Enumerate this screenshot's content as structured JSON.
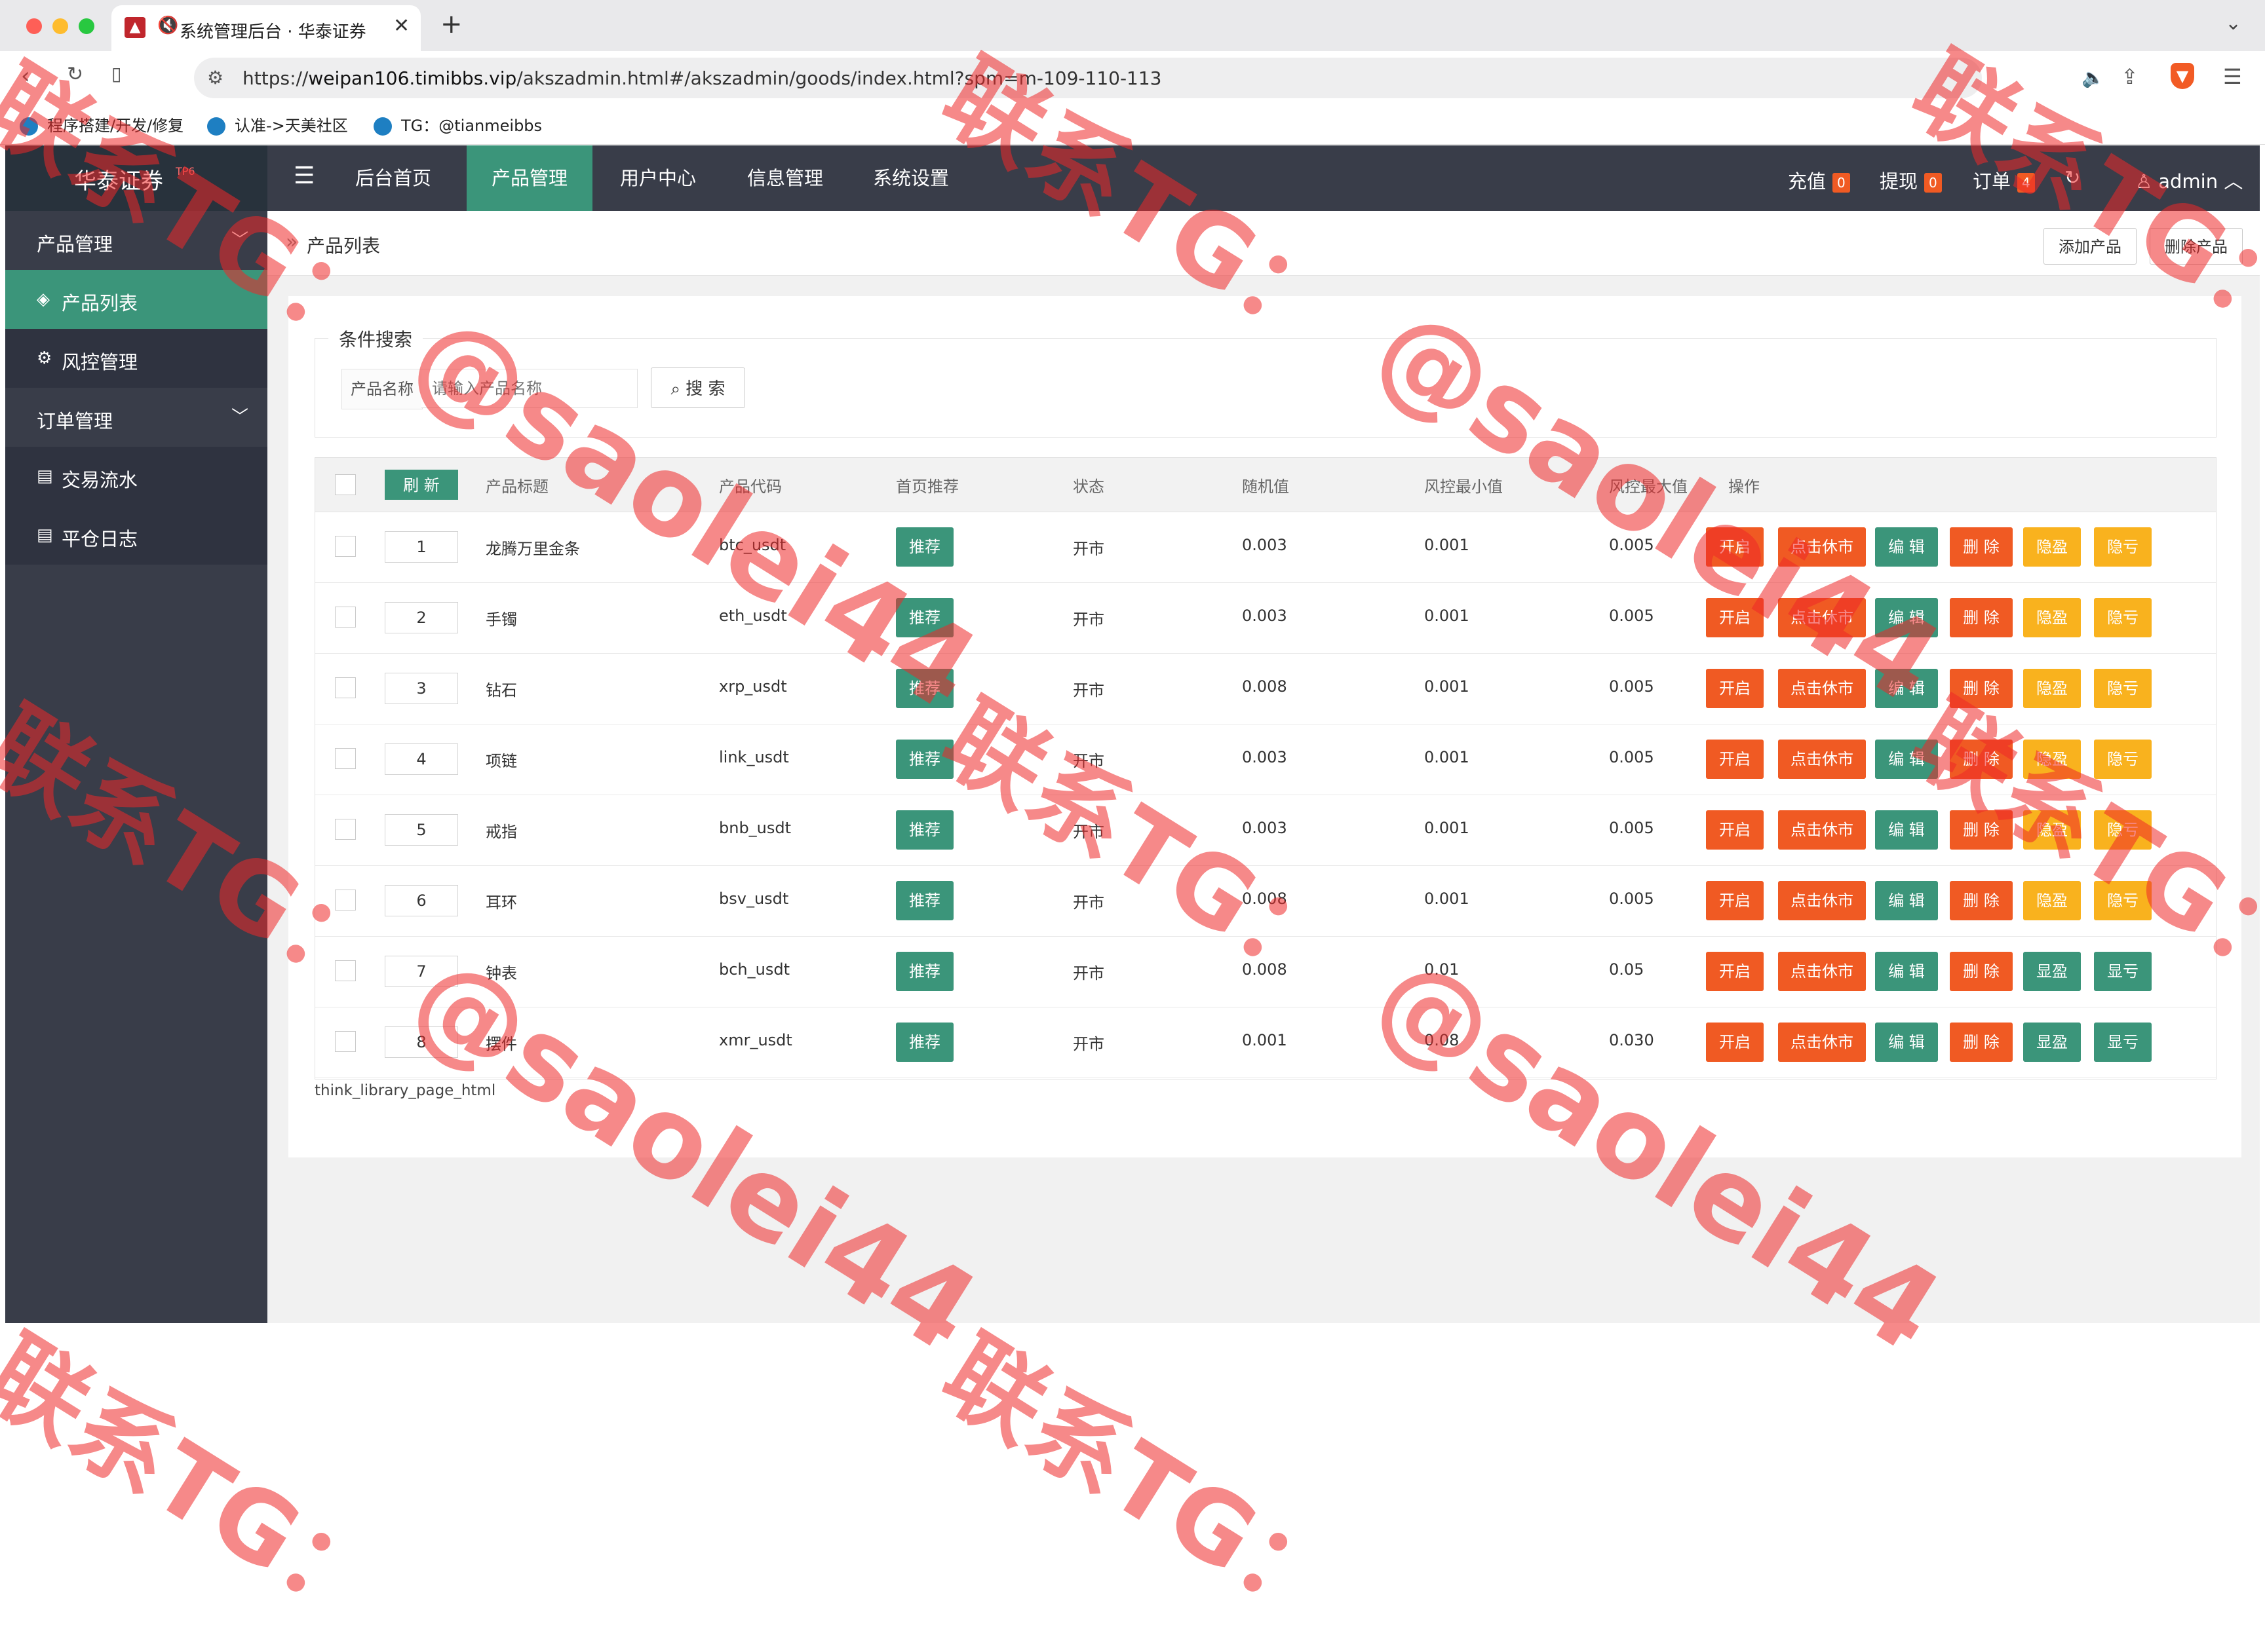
{
  "browser": {
    "tab_title": "系统管理后台 · 华泰证券",
    "url_prefix": "https://",
    "url_host": "weipan106.timibbs.vip",
    "url_path": "/akszadmin.html#/akszadmin/goods/index.html?spm=m-109-110-113",
    "bookmarks": [
      "程序搭建/开发/修复",
      "认准->天美社区",
      "TG：@tianmeibbs"
    ]
  },
  "brand": {
    "name": "华泰证券",
    "tag": "TP6"
  },
  "topnav": {
    "items": [
      "后台首页",
      "产品管理",
      "用户中心",
      "信息管理",
      "系统设置"
    ],
    "active": "产品管理",
    "right": {
      "recharge_label": "充值",
      "recharge_count": "0",
      "withdraw_label": "提现",
      "withdraw_count": "0",
      "order_label": "订单",
      "order_count": "4",
      "user": "admin"
    }
  },
  "sidebar": {
    "groups": [
      {
        "label": "产品管理",
        "items": [
          "产品列表",
          "风控管理"
        ]
      },
      {
        "label": "订单管理",
        "items": [
          "交易流水",
          "平仓日志"
        ]
      }
    ],
    "active": "产品列表"
  },
  "breadcrumb": {
    "title": "产品列表",
    "add_button": "添加产品",
    "delete_button": "删除产品"
  },
  "search": {
    "legend": "条件搜索",
    "field_label": "产品名称",
    "placeholder": "请输入产品名称",
    "button": "搜 索"
  },
  "table": {
    "refresh_button": "刷 新",
    "columns": [
      "产品标题",
      "产品代码",
      "首页推荐",
      "状态",
      "随机值",
      "风控最小值",
      "风控最大值",
      "操作"
    ],
    "rows": [
      {
        "sort": "1",
        "title": "龙腾万里金条",
        "code": "btc_usdt",
        "recommend": "推荐",
        "status": "开市",
        "random": "0.003",
        "min": "0.001",
        "max": "0.005",
        "actions": [
          "开启",
          "点击休市",
          "编 辑",
          "删 除",
          "隐盈",
          "隐亏"
        ]
      },
      {
        "sort": "2",
        "title": "手镯",
        "code": "eth_usdt",
        "recommend": "推荐",
        "status": "开市",
        "random": "0.003",
        "min": "0.001",
        "max": "0.005",
        "actions": [
          "开启",
          "点击休市",
          "编 辑",
          "删 除",
          "隐盈",
          "隐亏"
        ]
      },
      {
        "sort": "3",
        "title": "钻石",
        "code": "xrp_usdt",
        "recommend": "推荐",
        "status": "开市",
        "random": "0.008",
        "min": "0.001",
        "max": "0.005",
        "actions": [
          "开启",
          "点击休市",
          "编 辑",
          "删 除",
          "隐盈",
          "隐亏"
        ]
      },
      {
        "sort": "4",
        "title": "项链",
        "code": "link_usdt",
        "recommend": "推荐",
        "status": "开市",
        "random": "0.003",
        "min": "0.001",
        "max": "0.005",
        "actions": [
          "开启",
          "点击休市",
          "编 辑",
          "删 除",
          "隐盈",
          "隐亏"
        ]
      },
      {
        "sort": "5",
        "title": "戒指",
        "code": "bnb_usdt",
        "recommend": "推荐",
        "status": "开市",
        "random": "0.003",
        "min": "0.001",
        "max": "0.005",
        "actions": [
          "开启",
          "点击休市",
          "编 辑",
          "删 除",
          "隐盈",
          "隐亏"
        ]
      },
      {
        "sort": "6",
        "title": "耳环",
        "code": "bsv_usdt",
        "recommend": "推荐",
        "status": "开市",
        "random": "0.008",
        "min": "0.001",
        "max": "0.005",
        "actions": [
          "开启",
          "点击休市",
          "编 辑",
          "删 除",
          "隐盈",
          "隐亏"
        ]
      },
      {
        "sort": "7",
        "title": "钟表",
        "code": "bch_usdt",
        "recommend": "推荐",
        "status": "开市",
        "random": "0.008",
        "min": "0.01",
        "max": "0.05",
        "actions": [
          "开启",
          "点击休市",
          "编 辑",
          "删 除",
          "显盈",
          "显亏"
        ]
      },
      {
        "sort": "8",
        "title": "摆件",
        "code": "xmr_usdt",
        "recommend": "推荐",
        "status": "开市",
        "random": "0.001",
        "min": "0.08",
        "max": "0.030",
        "actions": [
          "开启",
          "点击休市",
          "编 辑",
          "删 除",
          "显盈",
          "显亏"
        ]
      }
    ],
    "pager_text": "think_library_page_html"
  },
  "watermarks": {
    "contact": "联系TG：",
    "handle": "@saolei44"
  },
  "colors": {
    "nav_bg": "#393d49",
    "accent": "#3b957a",
    "orange_red": "#f05a23",
    "orange": "#f37b1d",
    "yellow": "#f9b21e",
    "watermark": "#ee2828"
  }
}
